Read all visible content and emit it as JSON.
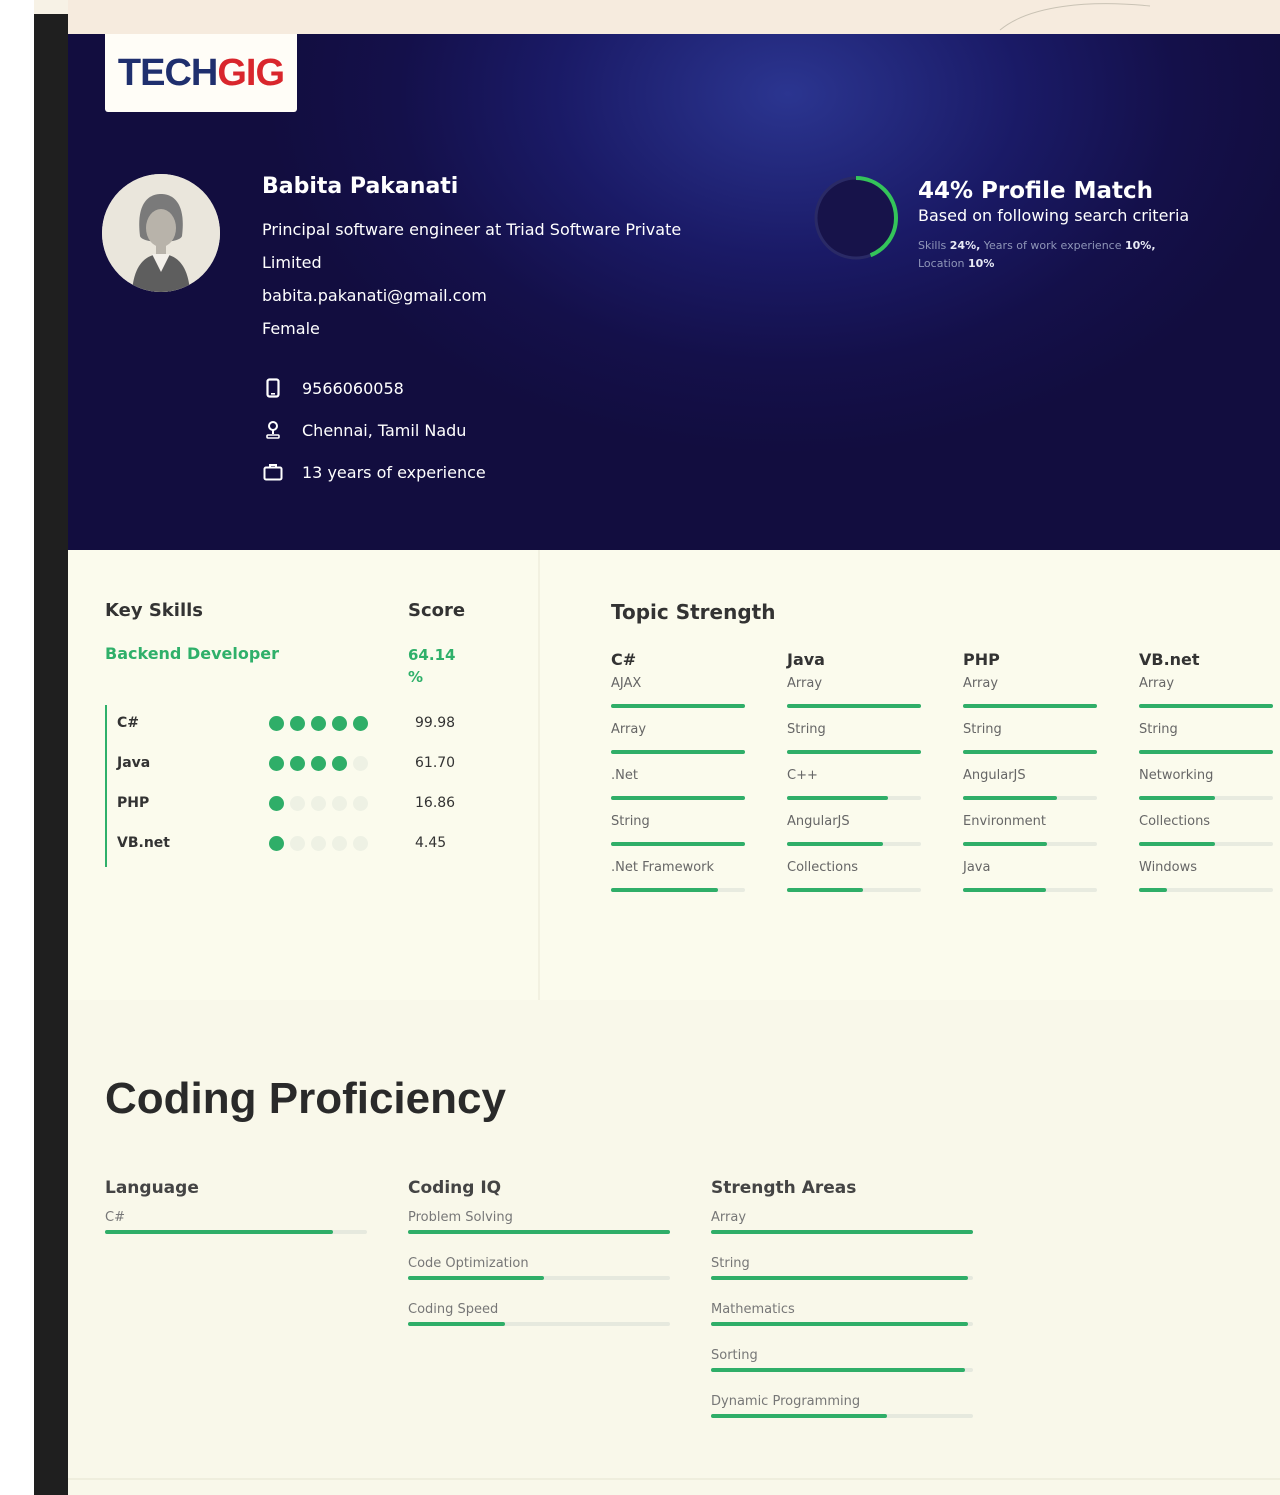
{
  "logo": {
    "tech": "TECH",
    "gig": "GIG"
  },
  "colors": {
    "accent_green": "#2fae68",
    "hero_bg": "#14104a",
    "logo_red": "#d9262c",
    "logo_navy": "#1f2f6e"
  },
  "profile": {
    "name": "Babita Pakanati",
    "title_line1": "Principal software engineer at Triad Software Private",
    "title_line2": "Limited",
    "email": "babita.pakanati@gmail.com",
    "gender": "Female",
    "phone": "9566060058",
    "location": "Chennai, Tamil Nadu",
    "experience": "13 years of experience",
    "icons": {
      "phone": "mobile-icon",
      "location": "location-pin-icon",
      "experience": "briefcase-icon"
    }
  },
  "match": {
    "percent": 44,
    "title": "44% Profile Match",
    "subtitle": "Based on following search criteria",
    "crit_skills_label": "Skills",
    "crit_skills_val": "24%,",
    "crit_exp_label": "Years of work experience",
    "crit_exp_val": "10%,",
    "crit_loc_label": "Location",
    "crit_loc_val": "10%"
  },
  "key_skills": {
    "heading": "Key Skills",
    "score_heading": "Score",
    "role": "Backend Developer",
    "role_score": "64.14 %",
    "items": [
      {
        "name": "C#",
        "dots": 5,
        "score": "99.98"
      },
      {
        "name": "Java",
        "dots": 4,
        "score": "61.70"
      },
      {
        "name": "PHP",
        "dots": 1,
        "score": "16.86"
      },
      {
        "name": "VB.net",
        "dots": 1,
        "score": "4.45"
      }
    ]
  },
  "topic_strength": {
    "heading": "Topic Strength",
    "columns": [
      {
        "name": "C#",
        "items": [
          {
            "label": "AJAX",
            "level": 1.0
          },
          {
            "label": "Array",
            "level": 1.0
          },
          {
            "label": ".Net",
            "level": 1.0
          },
          {
            "label": "String",
            "level": 1.0
          },
          {
            "label": ".Net Framework",
            "level": 0.8
          }
        ]
      },
      {
        "name": "Java",
        "items": [
          {
            "label": "Array",
            "level": 1.0
          },
          {
            "label": "String",
            "level": 1.0
          },
          {
            "label": "C++",
            "level": 0.75
          },
          {
            "label": "AngularJS",
            "level": 0.72
          },
          {
            "label": "Collections",
            "level": 0.57
          }
        ]
      },
      {
        "name": "PHP",
        "items": [
          {
            "label": "Array",
            "level": 1.0
          },
          {
            "label": "String",
            "level": 1.0
          },
          {
            "label": "AngularJS",
            "level": 0.7
          },
          {
            "label": "Environment",
            "level": 0.63
          },
          {
            "label": "Java",
            "level": 0.62
          }
        ]
      },
      {
        "name": "VB.net",
        "items": [
          {
            "label": "Array",
            "level": 1.0
          },
          {
            "label": "String",
            "level": 1.0
          },
          {
            "label": "Networking",
            "level": 0.57
          },
          {
            "label": "Collections",
            "level": 0.57
          },
          {
            "label": "Windows",
            "level": 0.21
          }
        ]
      }
    ]
  },
  "coding": {
    "heading": "Coding Proficiency",
    "columns": [
      {
        "name": "Language",
        "items": [
          {
            "label": "C#",
            "level": 0.87
          }
        ]
      },
      {
        "name": "Coding IQ",
        "items": [
          {
            "label": "Problem Solving",
            "level": 1.0
          },
          {
            "label": "Code Optimization",
            "level": 0.52
          },
          {
            "label": "Coding Speed",
            "level": 0.37
          }
        ]
      },
      {
        "name": "Strength Areas",
        "items": [
          {
            "label": "Array",
            "level": 1.0
          },
          {
            "label": "String",
            "level": 0.98
          },
          {
            "label": "Mathematics",
            "level": 0.98
          },
          {
            "label": "Sorting",
            "level": 0.97
          },
          {
            "label": "Dynamic Programming",
            "level": 0.67
          }
        ]
      }
    ]
  }
}
